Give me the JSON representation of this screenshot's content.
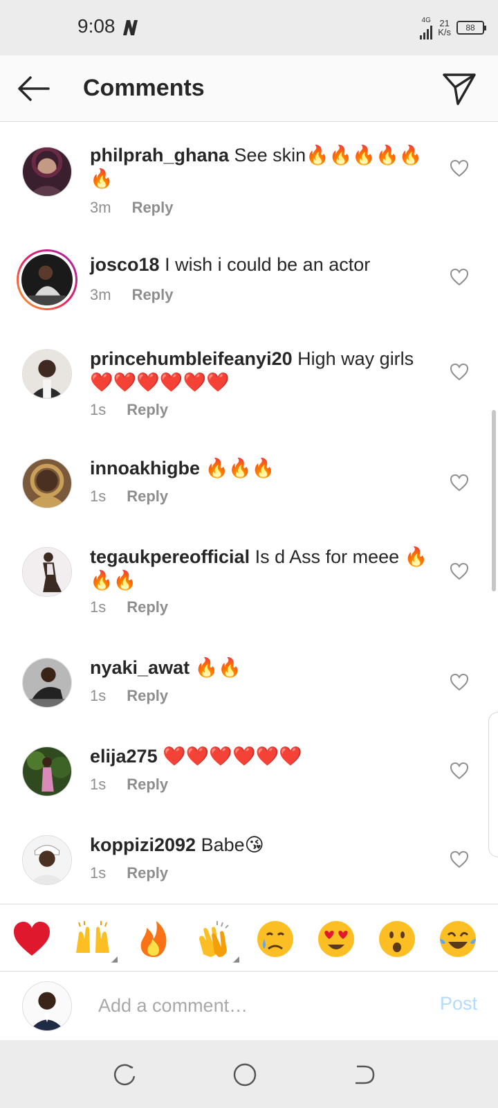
{
  "status_bar": {
    "time": "9:08",
    "network": "4G",
    "speed_value": "21",
    "speed_unit": "K/s",
    "battery": "88"
  },
  "header": {
    "title": "Comments",
    "back_icon": "arrow-left-icon",
    "send_icon": "paper-plane-icon"
  },
  "comments": [
    {
      "username": "philprah_ghana",
      "text": "See skin🔥🔥🔥🔥🔥🔥",
      "time": "3m",
      "reply_label": "Reply",
      "avatar_icon": "avatar-photo"
    },
    {
      "username": "josco18",
      "text": "I wish i could be an actor",
      "time": "3m",
      "reply_label": "Reply",
      "avatar_icon": "avatar-photo-story-ring"
    },
    {
      "username": "princehumbleifeanyi20",
      "text": "High way girls ❤️❤️❤️❤️❤️❤️",
      "time": "1s",
      "reply_label": "Reply",
      "avatar_icon": "avatar-photo"
    },
    {
      "username": "innoakhigbe",
      "text": "🔥🔥🔥",
      "time": "1s",
      "reply_label": "Reply",
      "avatar_icon": "avatar-photo"
    },
    {
      "username": "tegaukpereofficial",
      "text": "Is d Ass for meee 🔥🔥🔥",
      "time": "1s",
      "reply_label": "Reply",
      "avatar_icon": "avatar-photo"
    },
    {
      "username": "nyaki_awat",
      "text": "🔥🔥",
      "time": "1s",
      "reply_label": "Reply",
      "avatar_icon": "avatar-photo"
    },
    {
      "username": "elija275",
      "text": "❤️❤️❤️❤️❤️❤️",
      "time": "1s",
      "reply_label": "Reply",
      "avatar_icon": "avatar-photo"
    },
    {
      "username": "koppizi2092",
      "text": "Babe😘",
      "time": "1s",
      "reply_label": "Reply",
      "avatar_icon": "avatar-photo"
    }
  ],
  "emoji_bar": [
    "red-heart",
    "raising-hands",
    "fire",
    "clapping-hands",
    "crying-face",
    "heart-eyes",
    "surprised-face",
    "tears-of-joy"
  ],
  "compose": {
    "placeholder": "Add a comment…",
    "post_label": "Post"
  },
  "colors": {
    "accent_disabled": "#b3dbff",
    "heart_red": "#e0182d",
    "text_primary": "#262626",
    "text_secondary": "#8e8e8e"
  }
}
